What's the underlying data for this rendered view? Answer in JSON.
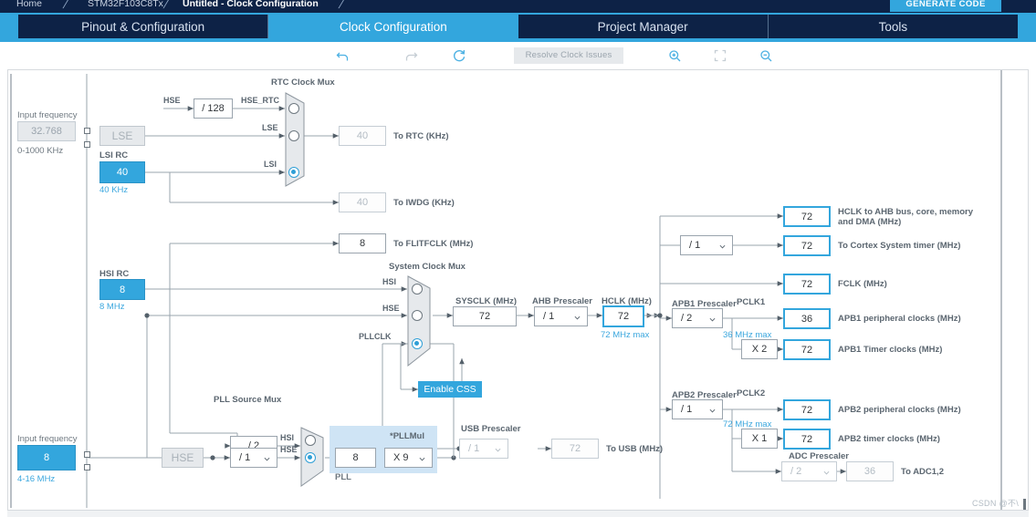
{
  "breadcrumb": {
    "items": [
      {
        "label": "Home",
        "active": false
      },
      {
        "label": "STM32F103C8Tx",
        "active": false
      },
      {
        "label": "Untitled - Clock Configuration",
        "active": true
      }
    ],
    "generate_code_label": "GENERATE CODE"
  },
  "tabs": [
    {
      "label": "Pinout & Configuration",
      "selected": false
    },
    {
      "label": "Clock Configuration",
      "selected": true
    },
    {
      "label": "Project Manager",
      "selected": false
    },
    {
      "label": "Tools",
      "selected": false
    }
  ],
  "toolbar": {
    "undo": "undo-icon",
    "redo": "redo-icon",
    "refresh": "refresh-icon",
    "resolve_label": "Resolve Clock Issues",
    "zoom_in": "zoom-in-icon",
    "fit": "fit-to-screen-icon",
    "zoom_out": "zoom-out-icon"
  },
  "diagram": {
    "lse": {
      "input_frequency_label": "Input frequency",
      "input_frequency_value": "32.768",
      "range_label": "0-1000 KHz",
      "osc_label": "LSE"
    },
    "lsi": {
      "title": "LSI RC",
      "value": "40",
      "unit": "40 KHz"
    },
    "hsi": {
      "title": "HSI RC",
      "value": "8",
      "unit": "8 MHz"
    },
    "hse": {
      "input_frequency_label": "Input frequency",
      "input_frequency_value": "8",
      "range_label": "4-16 MHz",
      "osc_label": "HSE"
    },
    "hse_rtc_div": "/ 128",
    "signals": {
      "hse": "HSE",
      "hse_rtc": "HSE_RTC",
      "lse": "LSE",
      "lsi": "LSI",
      "hsi": "HSI",
      "hsi_sys": "HSI",
      "hse_sys": "HSE",
      "pllclk": "PLLCLK",
      "hsi_pll": "HSI",
      "hse_pll": "HSE",
      "pclk1": "PCLK1",
      "pclk2": "PCLK2"
    },
    "rtc_mux": {
      "title": "RTC Clock Mux",
      "selected_index": 2
    },
    "to_rtc": {
      "value": "40",
      "label": "To RTC (KHz)"
    },
    "to_iwdg": {
      "value": "40",
      "label": "To IWDG (KHz)"
    },
    "to_flitfclk": {
      "value": "8",
      "label": "To FLITFCLK (MHz)"
    },
    "sys_mux": {
      "title": "System Clock Mux",
      "selected_index": 2
    },
    "enable_css_label": "Enable CSS",
    "sysclk": {
      "label": "SYSCLK (MHz)",
      "value": "72"
    },
    "ahb_prescaler": {
      "label": "AHB Prescaler",
      "value": "/ 1"
    },
    "hclk": {
      "label": "HCLK (MHz)",
      "value": "72",
      "max": "72 MHz max"
    },
    "hclk_ahb_out": {
      "value": "72",
      "label": "HCLK to AHB bus, core, memory and DMA (MHz)"
    },
    "cortex_prescaler": {
      "value": "/ 1"
    },
    "cortex_timer_out": {
      "value": "72",
      "label": "To Cortex System timer (MHz)"
    },
    "fclk_out": {
      "value": "72",
      "label": "FCLK (MHz)"
    },
    "apb1": {
      "prescaler_label": "APB1 Prescaler",
      "prescaler_value": "/ 2",
      "pclk_label": "PCLK1",
      "max_label": "36 MHz max",
      "periph": {
        "value": "36",
        "label": "APB1 peripheral clocks (MHz)"
      },
      "timer_mult": "X 2",
      "timer": {
        "value": "72",
        "label": "APB1 Timer clocks (MHz)"
      }
    },
    "apb2": {
      "prescaler_label": "APB2 Prescaler",
      "prescaler_value": "/ 1",
      "pclk_label": "PCLK2",
      "max_label": "72 MHz max",
      "periph": {
        "value": "72",
        "label": "APB2 peripheral clocks (MHz)"
      },
      "timer_mult": "X 1",
      "timer": {
        "value": "72",
        "label": "APB2 timer clocks (MHz)"
      },
      "adc_prescaler_label": "ADC Prescaler",
      "adc_prescaler_value": "/ 2",
      "adc_out": {
        "value": "36",
        "label": "To ADC1,2"
      }
    },
    "pll": {
      "source_mux_title": "PLL Source Mux",
      "source_mux_selected_index": 1,
      "hsi_div": "/ 2",
      "hse_div": "/ 1",
      "group_label": "PLL",
      "input_value": "8",
      "mul_label": "*PLLMul",
      "mul_value": "X 9"
    },
    "usb": {
      "prescaler_label": "USB Prescaler",
      "prescaler_value": "/ 1",
      "value": "72",
      "label": "To USB (MHz)"
    }
  },
  "watermark": "CSDN @不\\",
  "colors": {
    "accent_blue": "#33a6dd",
    "dark_navy": "#0d2246",
    "wire_gray": "#9aa4ad",
    "pll_group": "#cfe4f5"
  }
}
